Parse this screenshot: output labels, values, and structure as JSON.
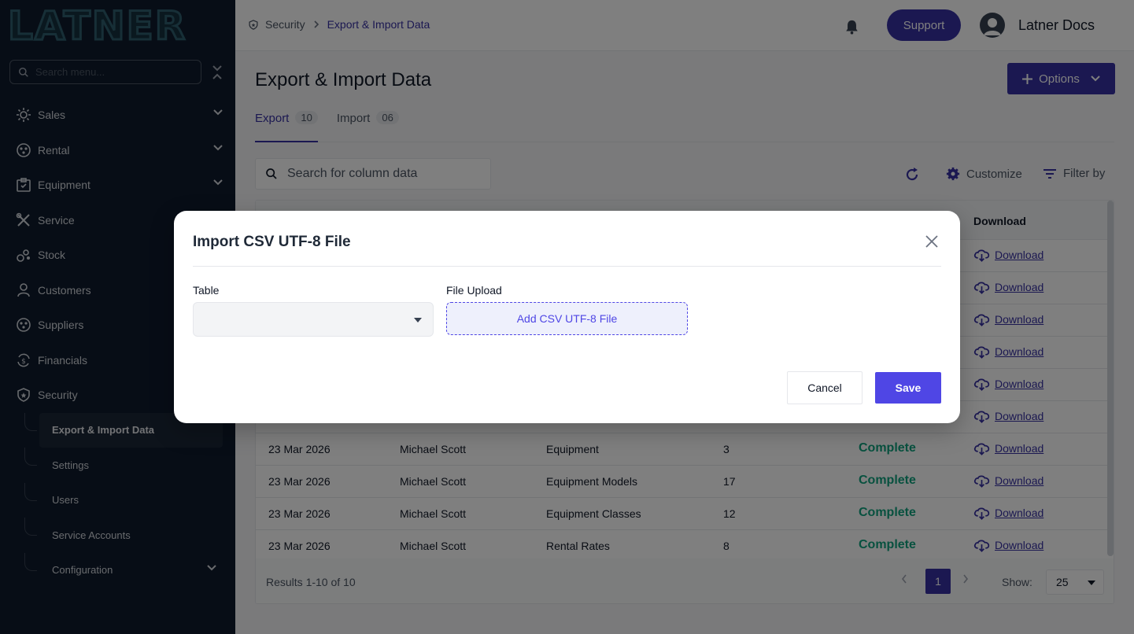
{
  "sidebar": {
    "logo_text": "LATNER",
    "search_placeholder": "Search menu...",
    "items": [
      {
        "label": "Sales",
        "icon": "sales-icon",
        "expandable": true
      },
      {
        "label": "Rental",
        "icon": "rental-icon",
        "expandable": true
      },
      {
        "label": "Equipment",
        "icon": "equipment-icon",
        "expandable": true
      },
      {
        "label": "Service",
        "icon": "service-icon",
        "expandable": false
      },
      {
        "label": "Stock",
        "icon": "stock-icon",
        "expandable": false
      },
      {
        "label": "Customers",
        "icon": "customers-icon",
        "expandable": false
      },
      {
        "label": "Suppliers",
        "icon": "suppliers-icon",
        "expandable": false
      },
      {
        "label": "Financials",
        "icon": "financials-icon",
        "expandable": false
      },
      {
        "label": "Security",
        "icon": "shield-icon",
        "expandable": false
      }
    ],
    "security_sub": [
      {
        "label": "Export & Import Data",
        "active": true
      },
      {
        "label": "Settings"
      },
      {
        "label": "Users"
      },
      {
        "label": "Service Accounts"
      },
      {
        "label": "Configuration"
      }
    ]
  },
  "header": {
    "breadcrumb_root": "Security",
    "breadcrumb_current": "Export & Import Data",
    "support_label": "Support",
    "user_name": "Latner Docs"
  },
  "page": {
    "title": "Export & Import Data",
    "options_label": "Options",
    "tabs": [
      {
        "label": "Export",
        "count": "10",
        "active": true
      },
      {
        "label": "Import",
        "count": "06",
        "active": false
      }
    ],
    "search_placeholder": "Search for column data",
    "customize_label": "Customize",
    "filter_label": "Filter by"
  },
  "table": {
    "download_header": "Download",
    "rows": [
      {
        "date": "",
        "user": "",
        "table": "",
        "rows": "",
        "status": "",
        "download": "Download"
      },
      {
        "date": "",
        "user": "",
        "table": "",
        "rows": "",
        "status": "",
        "download": "Download"
      },
      {
        "date": "",
        "user": "",
        "table": "",
        "rows": "",
        "status": "",
        "download": "Download"
      },
      {
        "date": "",
        "user": "",
        "table": "",
        "rows": "",
        "status": "",
        "download": "Download"
      },
      {
        "date": "",
        "user": "",
        "table": "",
        "rows": "",
        "status": "",
        "download": "Download"
      },
      {
        "date": "",
        "user": "",
        "table": "",
        "rows": "",
        "status": "",
        "download": "Download"
      },
      {
        "date": "23 Mar 2026",
        "user": "Michael Scott",
        "table": "Equipment",
        "rows": "3",
        "status": "Complete",
        "download": "Download"
      },
      {
        "date": "23 Mar 2026",
        "user": "Michael Scott",
        "table": "Equipment Models",
        "rows": "17",
        "status": "Complete",
        "download": "Download"
      },
      {
        "date": "23 Mar 2026",
        "user": "Michael Scott",
        "table": "Equipment Classes",
        "rows": "12",
        "status": "Complete",
        "download": "Download"
      },
      {
        "date": "23 Mar 2026",
        "user": "Michael Scott",
        "table": "Rental Rates",
        "rows": "8",
        "status": "Complete",
        "download": "Download"
      }
    ],
    "results_text": "Results 1-10 of 10",
    "current_page": "1",
    "show_label": "Show:",
    "page_size": "25"
  },
  "modal": {
    "title": "Import CSV UTF-8 File",
    "table_label": "Table",
    "table_value": "",
    "file_label": "File Upload",
    "file_button": "Add CSV UTF-8 File",
    "cancel_label": "Cancel",
    "save_label": "Save"
  },
  "colors": {
    "sidebar_bg": "#0f1b2d",
    "brand_primary": "#3730a3",
    "modal_primary": "#4f46e5",
    "status_complete": "#10a37f"
  }
}
